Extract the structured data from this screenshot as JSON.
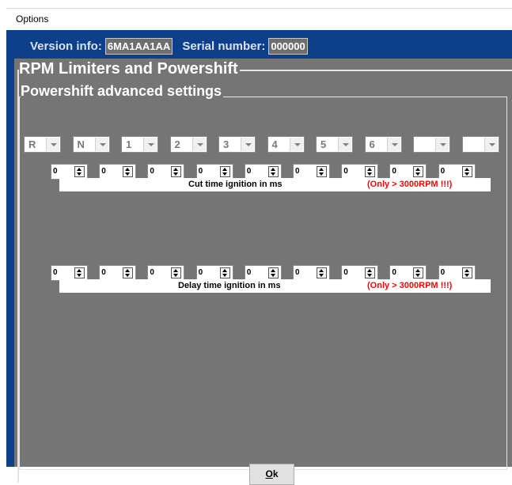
{
  "window": {
    "title": "Options"
  },
  "info": {
    "version_label": "Version info:",
    "version_value": "6MA1AA1AA",
    "serial_label": "Serial number:",
    "serial_value": "000000"
  },
  "group_outer": {
    "title": "RPM Limiters and Powershift"
  },
  "group_inner": {
    "title": "Powershift advanced settings"
  },
  "gears": [
    "R",
    "N",
    "1",
    "2",
    "3",
    "4",
    "5",
    "6",
    "",
    ""
  ],
  "cut_values": [
    "0",
    "0",
    "0",
    "0",
    "0",
    "0",
    "0",
    "0",
    "0"
  ],
  "cut": {
    "label": "Cut time ignition in ms",
    "warning": "(Only > 3000RPM !!!)"
  },
  "delay_values": [
    "0",
    "0",
    "0",
    "0",
    "0",
    "0",
    "0",
    "0",
    "0"
  ],
  "delay": {
    "label": "Delay time ignition in ms",
    "warning": "(Only > 3000RPM !!!)"
  },
  "ok_button": {
    "label_prefix": "O",
    "label_rest": "k"
  }
}
